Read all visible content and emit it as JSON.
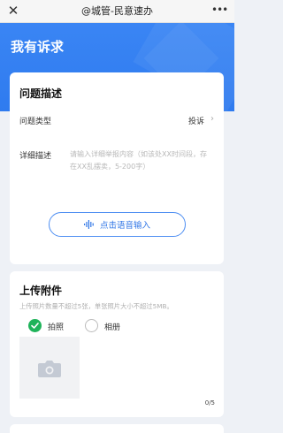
{
  "navbar": {
    "close_icon": "close-icon",
    "title": "@城管-民意速办",
    "more_icon": "more-icon"
  },
  "header": {
    "title": "我有诉求",
    "color": "#3a85f4"
  },
  "description_section": {
    "heading": "问题描述",
    "type_label": "问题类型",
    "type_value": "投诉",
    "detail_label": "详细描述",
    "detail_placeholder": "请输入详细举报内容（如该处XX时间段，存在XX乱摆卖，5-200字）",
    "voice_button_label": "点击语音输入",
    "voice_icon": "voice-wave-icon"
  },
  "upload_section": {
    "heading": "上传附件",
    "hint": "上传照片数量不超过5张，单张照片大小不超过5MB。",
    "option_photo": "拍照",
    "option_album": "相册",
    "selected_option": "拍照",
    "selected_color": "#1fb35a",
    "camera_icon": "camera-icon",
    "count": "0/5"
  }
}
